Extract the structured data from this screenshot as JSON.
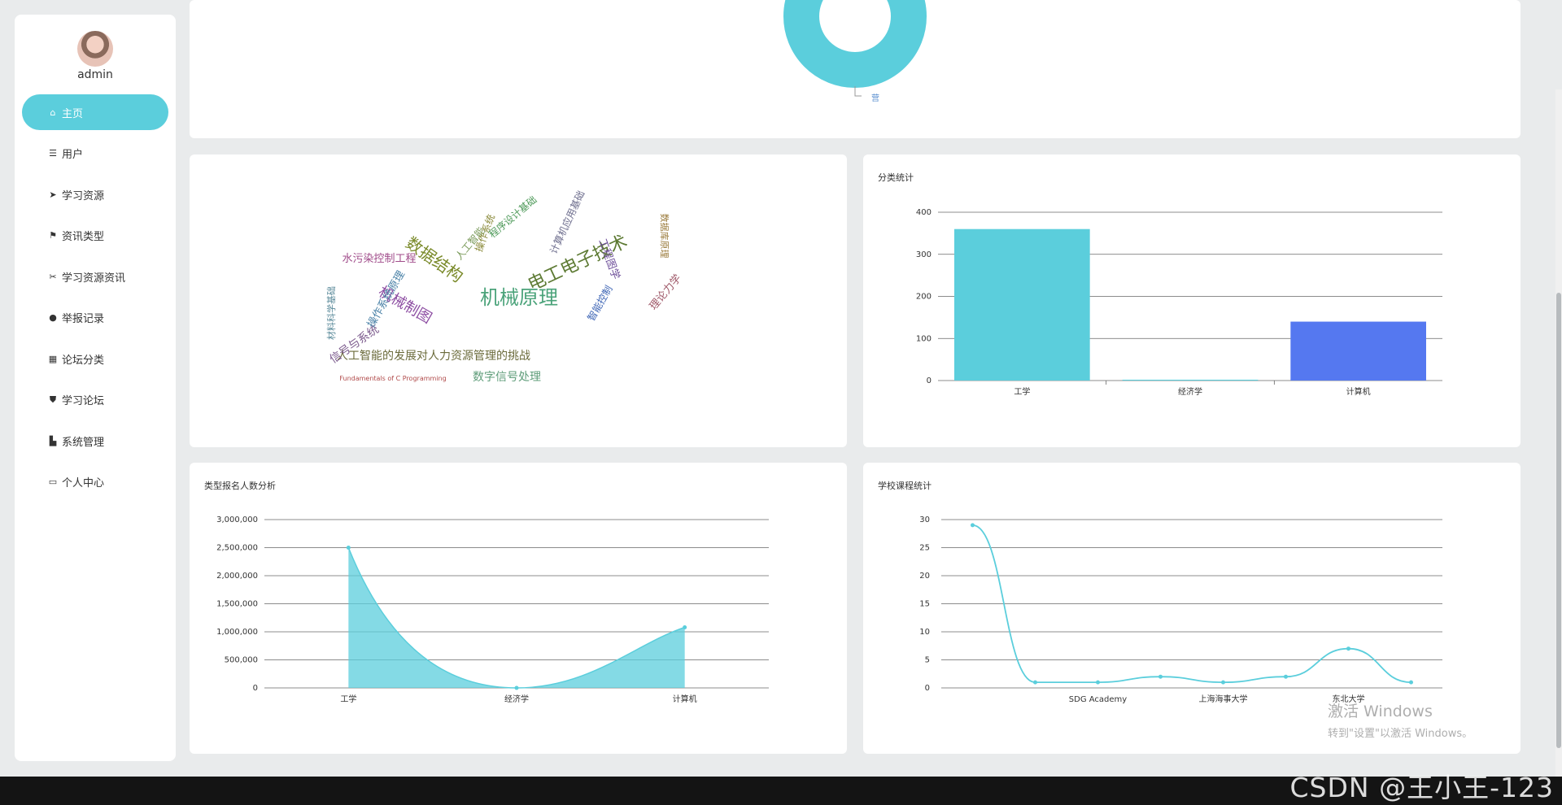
{
  "user": {
    "name": "admin"
  },
  "menu": [
    {
      "label": "主页",
      "icon": "home-icon",
      "glyph": "⌂",
      "active": true
    },
    {
      "label": "用户",
      "icon": "list-icon",
      "glyph": "☰"
    },
    {
      "label": "学习资源",
      "icon": "send-icon",
      "glyph": "➤"
    },
    {
      "label": "资讯类型",
      "icon": "flag-icon",
      "glyph": "⚑"
    },
    {
      "label": "学习资源资讯",
      "icon": "scissors-icon",
      "glyph": "✂"
    },
    {
      "label": "举报记录",
      "icon": "map-pin-icon",
      "glyph": "●"
    },
    {
      "label": "论坛分类",
      "icon": "grid-icon",
      "glyph": "▦"
    },
    {
      "label": "学习论坛",
      "icon": "shield-icon",
      "glyph": "⛊"
    },
    {
      "label": "系统管理",
      "icon": "thumbs-up-icon",
      "glyph": "▙"
    },
    {
      "label": "个人中心",
      "icon": "card-icon",
      "glyph": "▭"
    }
  ],
  "donut": {
    "legend_label": "营",
    "color": "#5bcedc"
  },
  "wordcloud": {
    "words": [
      {
        "text": "机械原理",
        "size": 24,
        "color": "#4ba37a"
      },
      {
        "text": "电工电子技术",
        "size": 22,
        "color": "#5d7a33"
      },
      {
        "text": "数据结构",
        "size": 20,
        "color": "#7a8a2a"
      },
      {
        "text": "机械制图",
        "size": 18,
        "color": "#8e4fa3"
      },
      {
        "text": "人工智能的发展对人力资源管理的挑战",
        "size": 14,
        "color": "#6b6b3b"
      },
      {
        "text": "数字信号处理",
        "size": 14,
        "color": "#5f9d7a"
      },
      {
        "text": "水污染控制工程",
        "size": 13,
        "color": "#a04b8a"
      },
      {
        "text": "信号与系统",
        "size": 14,
        "color": "#7d5c8e"
      },
      {
        "text": "操作系统原理",
        "size": 13,
        "color": "#4c83a8"
      },
      {
        "text": "智能控制",
        "size": 12,
        "color": "#3b63b4"
      },
      {
        "text": "工程图学",
        "size": 13,
        "color": "#6d4e99"
      },
      {
        "text": "理论力学",
        "size": 13,
        "color": "#a05a6a"
      },
      {
        "text": "人工智能",
        "size": 12,
        "color": "#7a9a5a"
      },
      {
        "text": "操作系统",
        "size": 12,
        "color": "#8a8a3a"
      },
      {
        "text": "程序设计基础",
        "size": 12,
        "color": "#4f9a5a"
      },
      {
        "text": "计算机应用基础",
        "size": 12,
        "color": "#6e6e8e"
      },
      {
        "text": "数据库原理",
        "size": 11,
        "color": "#9a7a3a"
      },
      {
        "text": "材料科学基础",
        "size": 11,
        "color": "#5a8a9a"
      },
      {
        "text": "Fundamentals of C Programming",
        "size": 8,
        "color": "#b04a4a"
      }
    ]
  },
  "bar_chart": {
    "title": "分类统计",
    "chart_data": {
      "type": "bar",
      "categories": [
        "工学",
        "经济学",
        "计算机"
      ],
      "values": [
        360,
        2,
        140
      ],
      "colors": [
        "#5bcedc",
        "#5bcedc",
        "#5578f0"
      ],
      "ylim": [
        0,
        400
      ],
      "yticks": [
        "0",
        "100",
        "200",
        "300",
        "400"
      ],
      "grid": true
    }
  },
  "area_chart": {
    "title": "类型报名人数分析",
    "chart_data": {
      "type": "area",
      "categories": [
        "工学",
        "经济学",
        "计算机"
      ],
      "values": [
        2500000,
        0,
        1080000
      ],
      "color": "#5bcedc",
      "ylim": [
        0,
        3000000
      ],
      "yticks": [
        "0",
        "500,000",
        "1,000,000",
        "1,500,000",
        "2,000,000",
        "2,500,000",
        "3,000,000"
      ],
      "grid": true
    }
  },
  "line_chart": {
    "title": "学校课程统计",
    "chart_data": {
      "type": "line",
      "values": [
        29,
        1,
        1,
        2,
        1,
        2,
        7,
        1
      ],
      "x_labels": [
        "",
        "",
        "SDG Academy",
        "",
        "上海海事大学",
        "",
        "东北大学",
        ""
      ],
      "color": "#5bcedc",
      "ylim": [
        0,
        30
      ],
      "yticks": [
        "0",
        "5",
        "10",
        "15",
        "20",
        "25",
        "30"
      ],
      "grid": true
    }
  },
  "overlay": {
    "windows_line1": "激活 Windows",
    "windows_line2": "转到\"设置\"以激活 Windows。",
    "watermark": "CSDN @王小王-123"
  }
}
